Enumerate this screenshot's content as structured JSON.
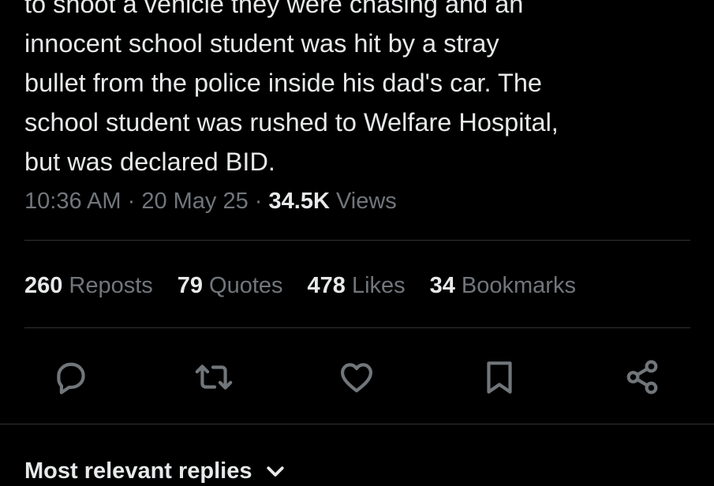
{
  "tweet": {
    "lines": [
      "to shoot a vehicle they were chasing and an",
      "innocent school student was hit by a stray",
      "bullet from the police inside his dad's car. The",
      "school student was rushed to Welfare Hospital,",
      "but was declared BID."
    ],
    "time": "10:36 AM",
    "date": "20 May 25",
    "separator": "·",
    "views_count": "34.5K",
    "views_label": "Views"
  },
  "stats": {
    "reposts": {
      "count": "260",
      "label": "Reposts"
    },
    "quotes": {
      "count": "79",
      "label": "Quotes"
    },
    "likes": {
      "count": "478",
      "label": "Likes"
    },
    "bookmarks": {
      "count": "34",
      "label": "Bookmarks"
    }
  },
  "actions": {
    "icons": [
      "reply-icon",
      "repost-icon",
      "like-icon",
      "bookmark-icon",
      "share-icon"
    ]
  },
  "replies": {
    "sort_label": "Most relevant replies"
  },
  "colors": {
    "background": "#000000",
    "text_primary": "#e7e9ea",
    "text_secondary": "#71767b",
    "divider": "#2f3336"
  }
}
